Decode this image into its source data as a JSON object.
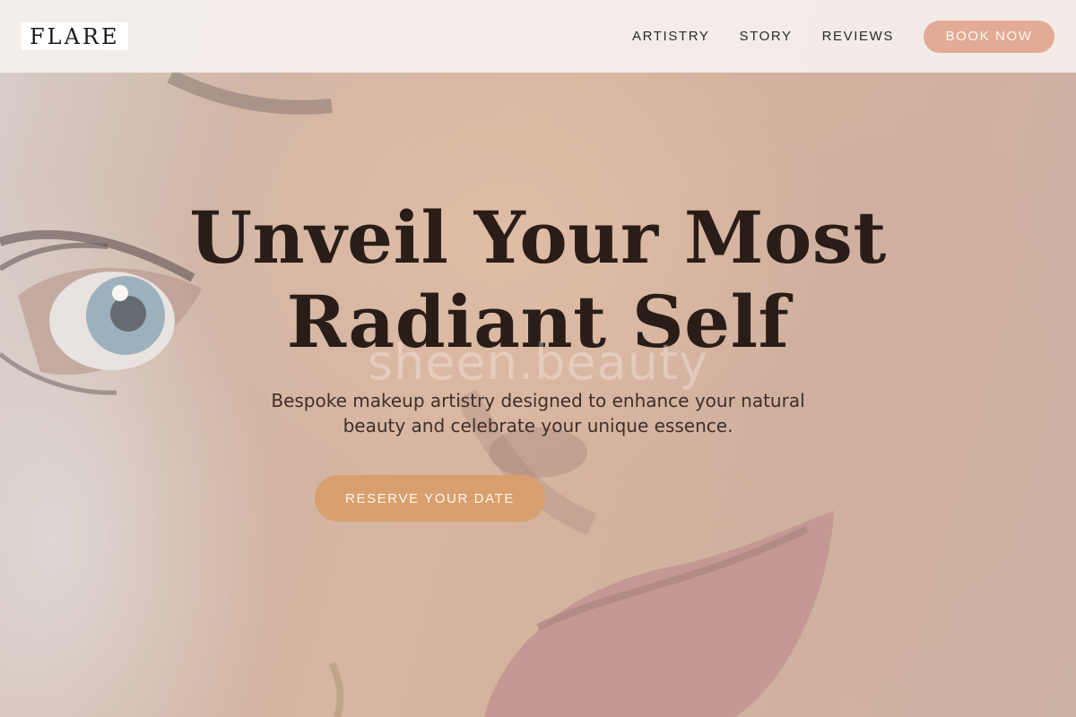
{
  "brand": {
    "logo_text": "FLARE"
  },
  "nav": {
    "links": [
      "ARTISTRY",
      "STORY",
      "REVIEWS"
    ],
    "cta_label": "BOOK NOW"
  },
  "hero": {
    "headline_line1": "Unveil Your Most",
    "headline_line2": "Radiant Self",
    "watermark": "sheen.beauty",
    "subtitle_line1": "Bespoke makeup artistry designed to enhance your natural",
    "subtitle_line2": "beauty and celebrate your unique essence.",
    "primary_cta": "RESERVE YOUR DATE",
    "secondary_cta": ""
  },
  "colors": {
    "accent_peach": "#e2ab94",
    "accent_gold": "#d7a06e",
    "text_dark": "#2a1d17"
  }
}
